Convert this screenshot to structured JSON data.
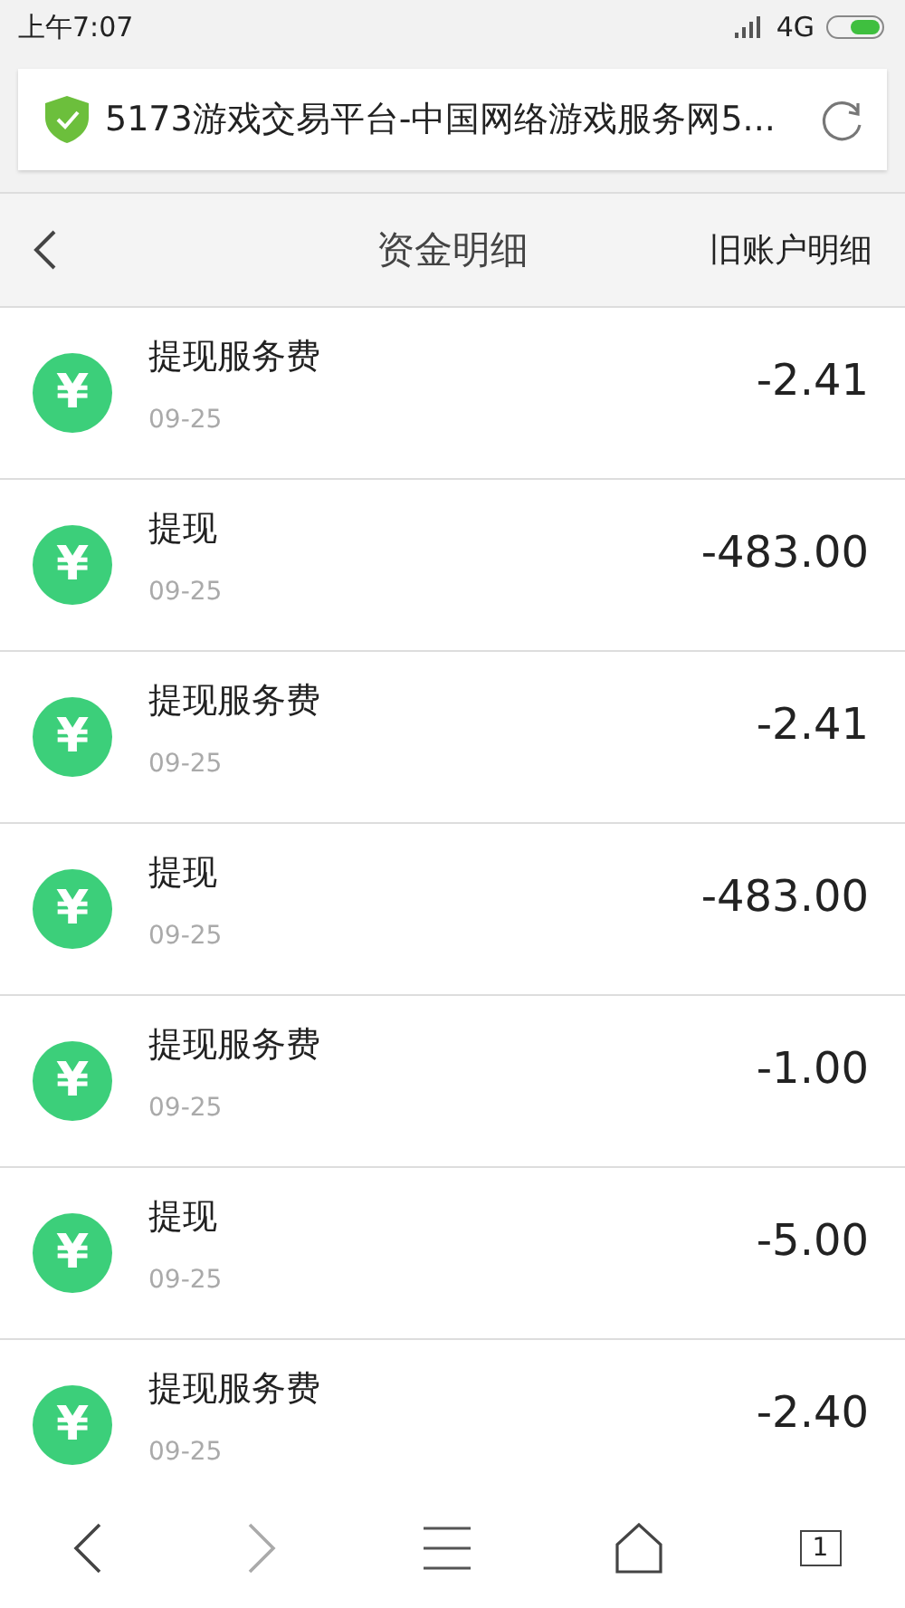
{
  "status_bar": {
    "time": "上午7:07",
    "network": "4G"
  },
  "address_bar": {
    "title": "5173游戏交易平台-中国网络游戏服务网5..."
  },
  "header": {
    "title": "资金明细",
    "action": "旧账户明细"
  },
  "transactions": [
    {
      "icon": "¥",
      "name": "提现服务费",
      "date": "09-25",
      "amount": "-2.41"
    },
    {
      "icon": "¥",
      "name": "提现",
      "date": "09-25",
      "amount": "-483.00"
    },
    {
      "icon": "¥",
      "name": "提现服务费",
      "date": "09-25",
      "amount": "-2.41"
    },
    {
      "icon": "¥",
      "name": "提现",
      "date": "09-25",
      "amount": "-483.00"
    },
    {
      "icon": "¥",
      "name": "提现服务费",
      "date": "09-25",
      "amount": "-1.00"
    },
    {
      "icon": "¥",
      "name": "提现",
      "date": "09-25",
      "amount": "-5.00"
    },
    {
      "icon": "¥",
      "name": "提现服务费",
      "date": "09-25",
      "amount": "-2.40"
    }
  ],
  "bottom_bar": {
    "back_disabled": false,
    "forward_disabled": true,
    "tab_count": "1"
  }
}
